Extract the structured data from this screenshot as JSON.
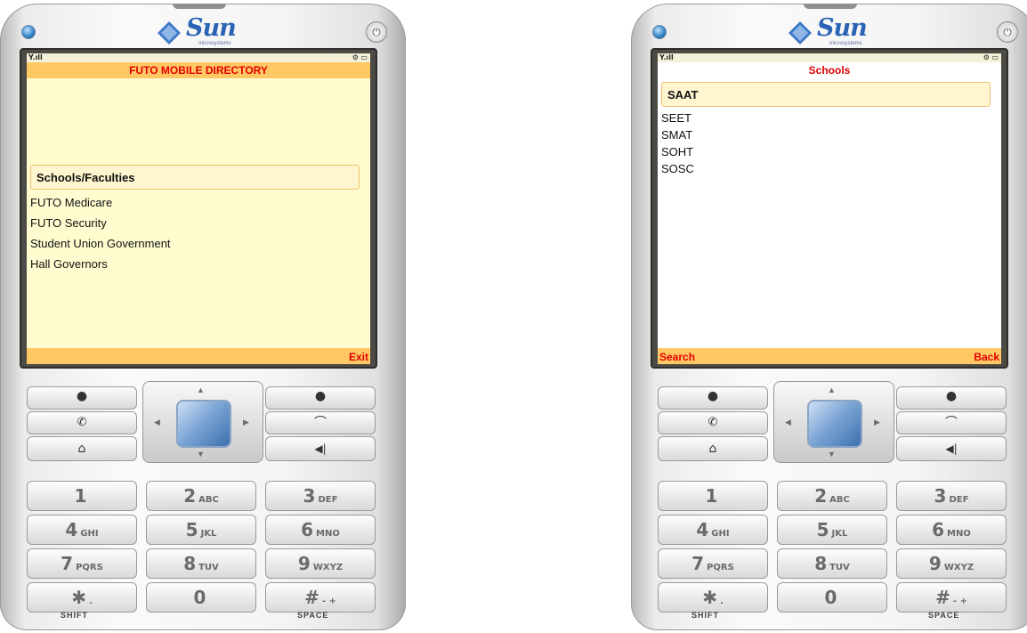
{
  "phones": [
    {
      "brand": "Sun",
      "brand_sub": "microsystems",
      "status_signal": "Y.ıll",
      "status_battery": "⚙ ▭",
      "title": "FUTO MOBILE DIRECTORY",
      "selected_item": "Schools/Faculties",
      "items": [
        "FUTO Medicare",
        "FUTO Security",
        "Student Union Government",
        "Hall Governors"
      ],
      "softkey_left": "",
      "softkey_right": "Exit"
    },
    {
      "brand": "Sun",
      "brand_sub": "microsystems",
      "status_signal": "Y.ıll",
      "status_battery": "⚙ ▭",
      "title": "Schools",
      "selected_item": "SAAT",
      "items": [
        "SEET",
        "SMAT",
        "SOHT",
        "SOSC"
      ],
      "softkey_left": "Search",
      "softkey_right": "Back"
    }
  ],
  "keypad": {
    "keys": [
      {
        "num": "1",
        "letters": ""
      },
      {
        "num": "2",
        "letters": "ABC"
      },
      {
        "num": "3",
        "letters": "DEF"
      },
      {
        "num": "4",
        "letters": "GHI"
      },
      {
        "num": "5",
        "letters": "JKL"
      },
      {
        "num": "6",
        "letters": "MNO"
      },
      {
        "num": "7",
        "letters": "PQRS"
      },
      {
        "num": "8",
        "letters": "TUV"
      },
      {
        "num": "9",
        "letters": "WXYZ"
      },
      {
        "num": "✱",
        "letters": "."
      },
      {
        "num": "0",
        "letters": ""
      },
      {
        "num": "#",
        "letters": "- +"
      }
    ],
    "shift_label": "SHIFT",
    "space_label": "SPACE",
    "icons": {
      "left_top": "●",
      "left_mid": "📞",
      "left_bot": "⌂",
      "right_top": "●",
      "right_mid": "⌒",
      "right_bot": "◀‖"
    }
  },
  "colors": {
    "accent_bar": "#ffc864",
    "accent_text": "#e00000",
    "screen_bg_1": "#fffcd0",
    "screen_bg_2": "#ffffff"
  }
}
